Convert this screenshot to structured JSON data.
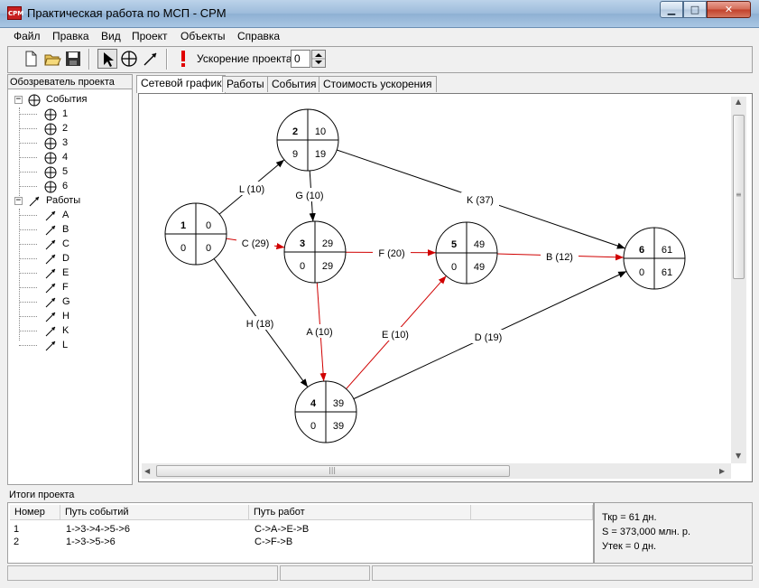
{
  "window": {
    "title": "Практическая работа по МСП - CPM",
    "icon_text": "CPM"
  },
  "menu": [
    "Файл",
    "Правка",
    "Вид",
    "Проект",
    "Объекты",
    "Справка"
  ],
  "toolbar": {
    "icons": [
      "new-file-icon",
      "open-folder-icon",
      "save-icon",
      "pointer-icon",
      "event-tool-icon",
      "work-tool-icon",
      "calculate-icon"
    ],
    "acceleration_label": "Ускорение проекта:",
    "acceleration_value": "0"
  },
  "explorer": {
    "title": "Обозреватель проекта",
    "events_label": "События",
    "events": [
      "1",
      "2",
      "3",
      "4",
      "5",
      "6"
    ],
    "works_label": "Работы",
    "works": [
      "A",
      "B",
      "C",
      "D",
      "E",
      "F",
      "G",
      "H",
      "K",
      "L"
    ]
  },
  "tabs": [
    "Сетевой график",
    "Работы",
    "События",
    "Стоимость ускорения"
  ],
  "graph": {
    "nodes": [
      {
        "id": "1",
        "early": "0",
        "late": "0",
        "reserve": "0"
      },
      {
        "id": "2",
        "early": "10",
        "late": "19",
        "reserve": "9"
      },
      {
        "id": "3",
        "early": "29",
        "late": "29",
        "reserve": "0"
      },
      {
        "id": "4",
        "early": "39",
        "late": "39",
        "reserve": "0"
      },
      {
        "id": "5",
        "early": "49",
        "late": "49",
        "reserve": "0"
      },
      {
        "id": "6",
        "early": "61",
        "late": "61",
        "reserve": "0"
      }
    ],
    "edges": [
      {
        "label": "L (10)",
        "from": "1",
        "to": "2",
        "critical": false
      },
      {
        "label": "C (29)",
        "from": "1",
        "to": "3",
        "critical": true
      },
      {
        "label": "H (18)",
        "from": "1",
        "to": "4",
        "critical": false
      },
      {
        "label": "G (10)",
        "from": "2",
        "to": "3",
        "critical": false
      },
      {
        "label": "K (37)",
        "from": "2",
        "to": "6",
        "critical": false
      },
      {
        "label": "F (20)",
        "from": "3",
        "to": "5",
        "critical": true
      },
      {
        "label": "A (10)",
        "from": "3",
        "to": "4",
        "critical": true
      },
      {
        "label": "E (10)",
        "from": "4",
        "to": "5",
        "critical": true
      },
      {
        "label": "D (19)",
        "from": "4",
        "to": "6",
        "critical": false
      },
      {
        "label": "B (12)",
        "from": "5",
        "to": "6",
        "critical": true
      }
    ],
    "colors": {
      "critical": "#d00000",
      "normal": "#000000"
    }
  },
  "results": {
    "title": "Итоги проекта",
    "columns": [
      "Номер",
      "Путь событий",
      "Путь работ",
      ""
    ],
    "rows": [
      {
        "num": "1",
        "events": "1->3->4->5->6",
        "works": "C->A->E->B"
      },
      {
        "num": "2",
        "events": "1->3->5->6",
        "works": "C->F->B"
      }
    ],
    "summary": [
      "Ткр = 61 дн.",
      "S = 373,000 млн. р.",
      "Утек = 0 дн."
    ]
  }
}
